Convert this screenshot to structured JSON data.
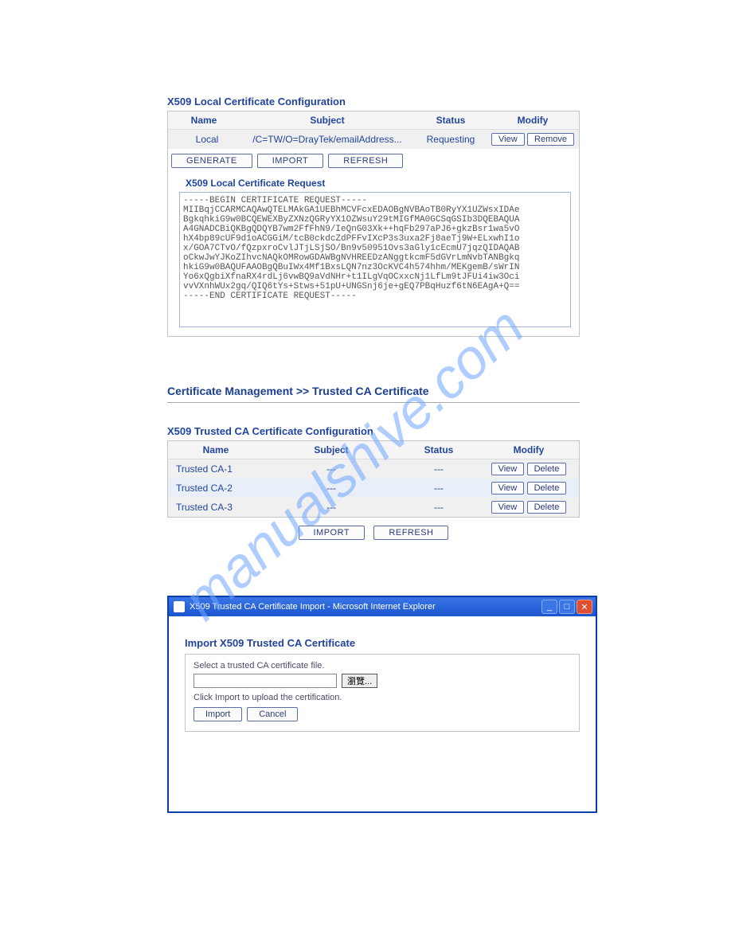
{
  "section1": {
    "title": "X509 Local Certificate Configuration",
    "headers": [
      "Name",
      "Subject",
      "Status",
      "Modify"
    ],
    "row": {
      "name": "Local",
      "subject": "/C=TW/O=DrayTek/emailAddress...",
      "status": "Requesting",
      "view": "View",
      "remove": "Remove"
    },
    "buttons": {
      "generate": "GENERATE",
      "import": "IMPORT",
      "refresh": "REFRESH"
    },
    "req_title": "X509 Local Certificate Request",
    "req_text": "-----BEGIN CERTIFICATE REQUEST-----\nMIIBqjCCARMCAQAwQTELMAkGA1UEBhMCVFcxEDAOBgNVBAoTB0RyYX1UZWsxIDAe\nBgkqhkiG9w0BCQEWEXByZXNzQGRyYX1OZWsuY29tMIGfMA0GCSqGSIb3DQEBAQUA\nA4GNADCBiQKBgQDQYB7wm2FfFhN9/IeQnG03Xk++hqFb297aPJ6+gkzBsr1wa5vO\nhX4bp89cUF9d1oACGGiM/tcB0ckdcZdPFFvIXcP3s3uxa2Fj8aeTj9W+ELxwhI1o\nx/GOA7CTvO/fQzpxroCvlJTjLSjSO/Bn9v50951Ovs3aGly1cEcmU7jqzQIDAQAB\noCkwJwYJKoZIhvcNAQkOMRowGDAWBgNVHREEDzANggtkcmF5dGVrLmNvbTANBgkq\nhkiG9w0BAQUFAAOBgQBuIWx4Mf1BxsLQN7nz3OcKVC4h574hhm/MEKgemB/sWrIN\nYo6xQgbiXfnaRX4rdLj6vwBQ9aVdNHr+t1ILgVqOCxxcNj1LfLm9tJFUi4iw3Oci\nvvVXnhWUx2gq/QIQ6tYs+Stws+51pU+UNGSnj6je+gEQ7PBqHuzf6tN6EAgA+Q==\n-----END CERTIFICATE REQUEST-----"
  },
  "breadcrumb": "Certificate Management >> Trusted CA Certificate",
  "section2": {
    "title": "X509 Trusted CA Certificate Configuration",
    "headers": [
      "Name",
      "Subject",
      "Status",
      "Modify"
    ],
    "rows": [
      {
        "name": "Trusted CA-1",
        "subject": "---",
        "status": "---",
        "view": "View",
        "delete": "Delete"
      },
      {
        "name": "Trusted CA-2",
        "subject": "---",
        "status": "---",
        "view": "View",
        "delete": "Delete"
      },
      {
        "name": "Trusted CA-3",
        "subject": "---",
        "status": "---",
        "view": "View",
        "delete": "Delete"
      }
    ],
    "buttons": {
      "import": "IMPORT",
      "refresh": "REFRESH"
    }
  },
  "dialog": {
    "title": "X509 Trusted CA Certificate Import - Microsoft Internet Explorer",
    "heading": "Import X509 Trusted CA Certificate",
    "select_label": "Select a trusted CA certificate file.",
    "browse": "瀏覽...",
    "click_label": "Click Import to upload the certification.",
    "import_btn": "Import",
    "cancel_btn": "Cancel"
  },
  "watermark_url": "manualshive.com"
}
